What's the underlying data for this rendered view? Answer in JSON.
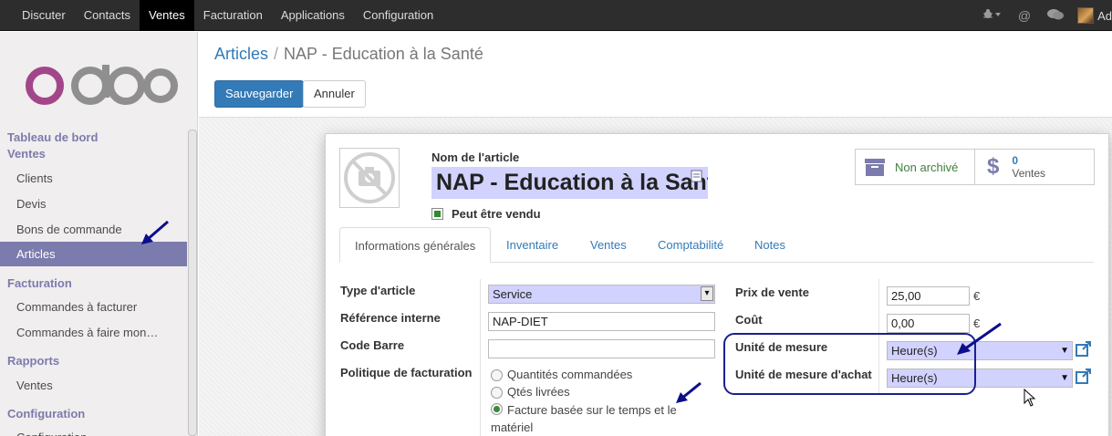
{
  "topbar": {
    "menu": [
      "Discuter",
      "Contacts",
      "Ventes",
      "Facturation",
      "Applications",
      "Configuration"
    ],
    "active_menu": "Ventes",
    "user_initials": "Ad"
  },
  "sidebar": {
    "logo": "odoo",
    "sections": [
      {
        "title": "Tableau de bord"
      },
      {
        "title": "Ventes",
        "items": [
          "Clients",
          "Devis",
          "Bons de commande",
          "Articles"
        ]
      },
      {
        "title": "Facturation",
        "items": [
          "Commandes à facturer",
          "Commandes à faire mon…"
        ]
      },
      {
        "title": "Rapports",
        "items": [
          "Ventes"
        ]
      },
      {
        "title": "Configuration",
        "items": [
          "Configuration"
        ]
      }
    ],
    "active_item": "Articles"
  },
  "breadcrumb": {
    "parent": "Articles",
    "current": "NAP - Education à la Santé"
  },
  "buttons": {
    "save": "Sauvegarder",
    "cancel": "Annuler"
  },
  "product": {
    "name_label": "Nom de l'article",
    "name_value": "NAP - Education à la Santé",
    "sale_ok_label": "Peut être vendu",
    "sale_ok": true
  },
  "smart_buttons": {
    "archive_label": "Non archivé",
    "sales_count": "0",
    "sales_label": "Ventes"
  },
  "tabs": [
    "Informations générales",
    "Inventaire",
    "Ventes",
    "Comptabilité",
    "Notes"
  ],
  "active_tab": "Informations générales",
  "fields": {
    "type_label": "Type d'article",
    "type_value": "Service",
    "ref_label": "Référence interne",
    "ref_value": "NAP-DIET",
    "barcode_label": "Code Barre",
    "barcode_value": "",
    "invoice_policy_label": "Politique de facturation",
    "invoice_options": [
      {
        "line1": "Quantités commandées",
        "line2": "",
        "selected": false
      },
      {
        "line1": "Qtés livrées",
        "line2": "",
        "selected": false
      },
      {
        "line1": "Facture basée sur le temps et le",
        "line2": "matériel",
        "selected": true
      }
    ],
    "price_label": "Prix de vente",
    "price_value": "25,00",
    "cost_label": "Coût",
    "cost_value": "0,00",
    "currency": "€",
    "uom_label": "Unité de mesure",
    "uom_value": "Heure(s)",
    "uom_po_label": "Unité de mesure d'achat",
    "uom_po_value": "Heure(s)"
  },
  "colors": {
    "topbar_bg": "#2d2d2d",
    "sidebar_active": "#7c7bad",
    "primary": "#337ab7",
    "required_field": "#d2d2ff",
    "annotation": "#1a1f8f"
  }
}
